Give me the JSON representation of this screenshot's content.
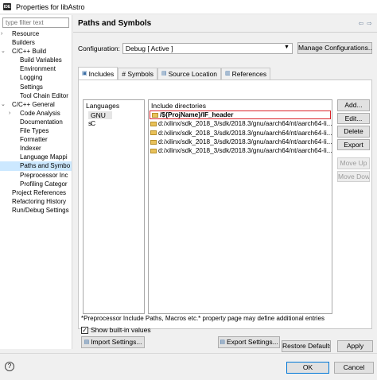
{
  "window": {
    "app_icon_text": "IDE",
    "title": "Properties for libAstro"
  },
  "filter": {
    "placeholder": "type filter text"
  },
  "tree": [
    {
      "label": "Resource",
      "indent": 1,
      "arrow": ">"
    },
    {
      "label": "Builders",
      "indent": 1,
      "arrow": ""
    },
    {
      "label": "C/C++ Build",
      "indent": 1,
      "arrow": "v"
    },
    {
      "label": "Build Variables",
      "indent": 2,
      "arrow": ""
    },
    {
      "label": "Environment",
      "indent": 2,
      "arrow": ""
    },
    {
      "label": "Logging",
      "indent": 2,
      "arrow": ""
    },
    {
      "label": "Settings",
      "indent": 2,
      "arrow": ""
    },
    {
      "label": "Tool Chain Editor",
      "indent": 2,
      "arrow": ""
    },
    {
      "label": "C/C++ General",
      "indent": 1,
      "arrow": "v"
    },
    {
      "label": "Code Analysis",
      "indent": 2,
      "arrow": ">"
    },
    {
      "label": "Documentation",
      "indent": 2,
      "arrow": ""
    },
    {
      "label": "File Types",
      "indent": 2,
      "arrow": ""
    },
    {
      "label": "Formatter",
      "indent": 2,
      "arrow": ""
    },
    {
      "label": "Indexer",
      "indent": 2,
      "arrow": ""
    },
    {
      "label": "Language Mappi",
      "indent": 2,
      "arrow": ""
    },
    {
      "label": "Paths and Symbo",
      "indent": 2,
      "arrow": "",
      "selected": true
    },
    {
      "label": "Preprocessor Inc",
      "indent": 2,
      "arrow": ""
    },
    {
      "label": "Profiling Categor",
      "indent": 2,
      "arrow": ""
    },
    {
      "label": "Project References",
      "indent": 1,
      "arrow": ""
    },
    {
      "label": "Refactoring History",
      "indent": 1,
      "arrow": ""
    },
    {
      "label": "Run/Debug Settings",
      "indent": 1,
      "arrow": ""
    }
  ],
  "page": {
    "title": "Paths and Symbols",
    "back_icon": "⇦",
    "forward_icon": "⇨"
  },
  "config": {
    "label": "Configuration:",
    "value": "Debug  [ Active ]",
    "manage_label": "Manage Configurations..."
  },
  "tabs": [
    {
      "label": "Includes",
      "icon": "▣",
      "active": true
    },
    {
      "label": "# Symbols",
      "icon": "",
      "active": false
    },
    {
      "label": "Source Location",
      "icon": "▤",
      "active": false
    },
    {
      "label": "References",
      "icon": "▥",
      "active": false
    }
  ],
  "languages": {
    "header": "Languages",
    "items": [
      "GNU C",
      "s"
    ]
  },
  "includes": {
    "header": "Include directories",
    "items": [
      {
        "path": "/${ProjName}/IF_header",
        "highlighted": true
      },
      {
        "path": "d:/xilinx/sdk_2018_3/sdk/2018.3/gnu/aarch64/nt/aarch64-li..."
      },
      {
        "path": "d:/xilinx/sdk_2018_3/sdk/2018.3/gnu/aarch64/nt/aarch64-li..."
      },
      {
        "path": "d:/xilinx/sdk_2018_3/sdk/2018.3/gnu/aarch64/nt/aarch64-li..."
      },
      {
        "path": "d:/xilinx/sdk_2018_3/sdk/2018.3/gnu/aarch64/nt/aarch64-li..."
      }
    ]
  },
  "side_buttons": {
    "add": "Add...",
    "edit": "Edit...",
    "delete": "Delete",
    "export": "Export",
    "move_up": "Move Up",
    "move_down": "Move Down"
  },
  "note": "*Preprocessor Include Paths, Macros etc.* property page may define additional entries",
  "show_builtin": {
    "label": "Show built-in values",
    "checked": true,
    "check_glyph": "✓"
  },
  "import_label": "Import Settings...",
  "export_label": "Export Settings...",
  "restore_label": "Restore Defaults",
  "apply_label": "Apply",
  "ok_label": "OK",
  "cancel_label": "Cancel",
  "help_glyph": "?"
}
